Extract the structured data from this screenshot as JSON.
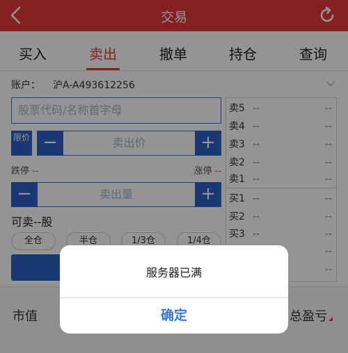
{
  "header": {
    "title": "交易"
  },
  "tabs": [
    {
      "label": "买入"
    },
    {
      "label": "卖出"
    },
    {
      "label": "撤单"
    },
    {
      "label": "持仓"
    },
    {
      "label": "查询"
    }
  ],
  "active_tab": "卖出",
  "account": {
    "label": "账户：",
    "value": "沪A-A493612256"
  },
  "form": {
    "code_placeholder": "股票代码/名称首字母",
    "limit_label": "限价",
    "price_placeholder": "卖出价",
    "qty_placeholder": "卖出量",
    "minus": "−",
    "plus": "+",
    "limit_down_label": "跌停",
    "limit_down_value": "--",
    "limit_up_label": "涨停",
    "limit_up_value": "--",
    "sellable": "可卖--股",
    "positions": [
      "全仓",
      "半仓",
      "1/3仓",
      "1/4仓"
    ]
  },
  "orderbook": {
    "sell": [
      {
        "name": "卖5",
        "price": "--",
        "vol": "--"
      },
      {
        "name": "卖4",
        "price": "--",
        "vol": "--"
      },
      {
        "name": "卖3",
        "price": "--",
        "vol": "--"
      },
      {
        "name": "卖2",
        "price": "--",
        "vol": "--"
      },
      {
        "name": "卖1",
        "price": "--",
        "vol": "--"
      }
    ],
    "buy": [
      {
        "name": "买1",
        "price": "--",
        "vol": "--"
      },
      {
        "name": "买2",
        "price": "--",
        "vol": "--"
      },
      {
        "name": "买3",
        "price": "--",
        "vol": "--"
      },
      {
        "name": "",
        "price": "",
        "vol": "--"
      },
      {
        "name": "",
        "price": "",
        "vol": "--"
      }
    ]
  },
  "summary": {
    "market_value_label": "市值",
    "total_pl_label": "总盈亏"
  },
  "dialog": {
    "message": "服务器已满",
    "ok_label": "确定"
  },
  "colors": {
    "header": "#e5393b",
    "accent_blue": "#2d63c8",
    "dialog_button": "#3a78d8"
  }
}
